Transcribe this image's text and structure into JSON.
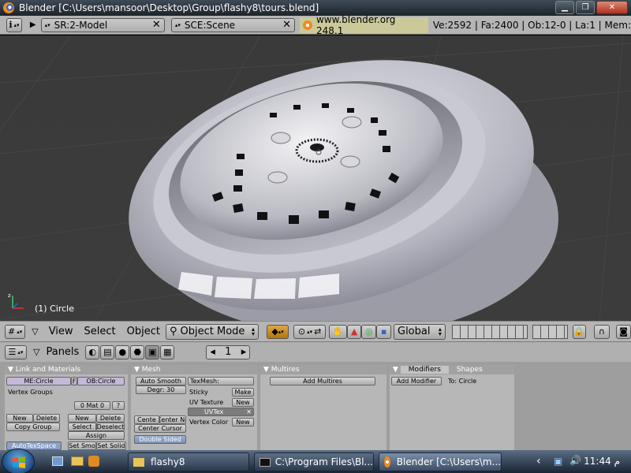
{
  "window": {
    "title": "Blender [C:\\Users\\mansoor\\Desktop\\Group\\flashy8\\tours.blend]"
  },
  "header": {
    "screen": "SR:2-Model",
    "scene": "SCE:Scene",
    "url": "www.blender.org 248.1",
    "stats": "Ve:2592 | Fa:2400 | Ob:12-0 | La:1 | Mem:"
  },
  "viewport": {
    "object_label": "(1) Circle"
  },
  "view3d_header": {
    "menus": [
      "View",
      "Select",
      "Object"
    ],
    "mode": "Object Mode",
    "orientation": "Global"
  },
  "buttons_header": {
    "panels_label": "Panels",
    "frame": "1"
  },
  "panels": {
    "link": {
      "title": "Link and Materials",
      "me_field": "ME:Circle",
      "f_label": "F",
      "ob_field": "OB:Circle",
      "vertex_groups": "Vertex Groups",
      "new": "New",
      "delete": "Delete",
      "copy_group": "Copy Group",
      "mat": "0 Mat 0",
      "mat_q": "?",
      "new2": "New",
      "delete2": "Delete",
      "select": "Select",
      "deselect": "Deselect",
      "assign": "Assign",
      "auto_tex_space": "AutoTexSpace",
      "set_smo": "Set Smo",
      "set_solid": "Set Solid"
    },
    "mesh": {
      "title": "Mesh",
      "auto_smooth": "Auto Smooth",
      "degr": "Degr: 30",
      "center": "Cente",
      "center_new": "Center Ne",
      "center_cursor": "Center Cursor",
      "double_sided": "Double Sided",
      "texmesh": "TexMesh:",
      "sticky": "Sticky",
      "make": "Make",
      "uv_texture": "UV Texture",
      "new": "New",
      "uvtex": "UVTex",
      "vertex_color": "Vertex Color",
      "new2": "New"
    },
    "multires": {
      "title": "Multires",
      "add": "Add Multires"
    },
    "modifiers": {
      "tab1": "Modifiers",
      "tab2": "Shapes",
      "add": "Add Modifier",
      "to": "To: Circle"
    }
  },
  "taskbar": {
    "tasks": [
      "flashy8",
      "C:\\Program Files\\Bl...",
      "Blender [C:\\Users\\m..."
    ],
    "clock": "11:44 م"
  }
}
